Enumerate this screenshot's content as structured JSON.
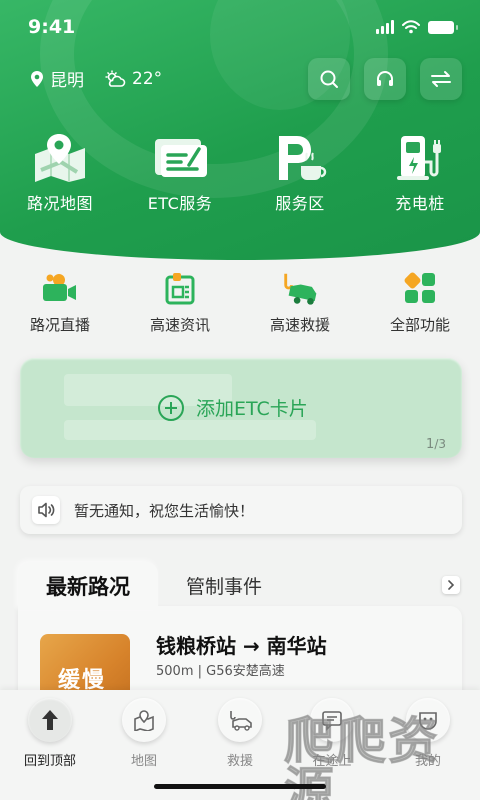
{
  "status_bar": {
    "time": "9:41"
  },
  "location": {
    "city": "昆明",
    "temperature": "22°"
  },
  "top_actions": [
    {
      "name": "search-button",
      "icon": "search-icon"
    },
    {
      "name": "support-button",
      "icon": "headset-icon"
    },
    {
      "name": "switch-button",
      "icon": "swap-icon"
    }
  ],
  "main_services": [
    {
      "label": "路况地图",
      "icon": "map-icon"
    },
    {
      "label": "ETC服务",
      "icon": "etc-card-icon"
    },
    {
      "label": "服务区",
      "icon": "service-area-icon"
    },
    {
      "label": "充电桩",
      "icon": "charging-pile-icon"
    }
  ],
  "sub_services": [
    {
      "label": "路况直播",
      "icon": "live-camera-icon"
    },
    {
      "label": "高速资讯",
      "icon": "news-icon"
    },
    {
      "label": "高速救援",
      "icon": "tow-truck-icon"
    },
    {
      "label": "全部功能",
      "icon": "all-apps-icon"
    }
  ],
  "etc_card": {
    "add_label": "添加ETC卡片",
    "page_current": "1",
    "page_total": "/3"
  },
  "notice": {
    "text": "暂无通知，祝您生活愉快！"
  },
  "news": {
    "tabs": [
      "最新路况",
      "管制事件"
    ],
    "item": {
      "badge": "缓慢",
      "title": "钱粮桥站 → 南华站",
      "subtitle": "500m | G56安楚高速"
    }
  },
  "tabbar": [
    {
      "label": "回到顶部",
      "icon": "arrow-up-icon"
    },
    {
      "label": "地图",
      "icon": "map-pin-icon"
    },
    {
      "label": "救援",
      "icon": "tow-icon"
    },
    {
      "label": "在途上",
      "icon": "message-icon"
    },
    {
      "label": "我的",
      "icon": "profile-icon"
    }
  ],
  "watermark": "爬爬资源",
  "colors": {
    "brand": "#1f9e4d",
    "accent": "#2aa557",
    "card": "#c5e6cd"
  }
}
